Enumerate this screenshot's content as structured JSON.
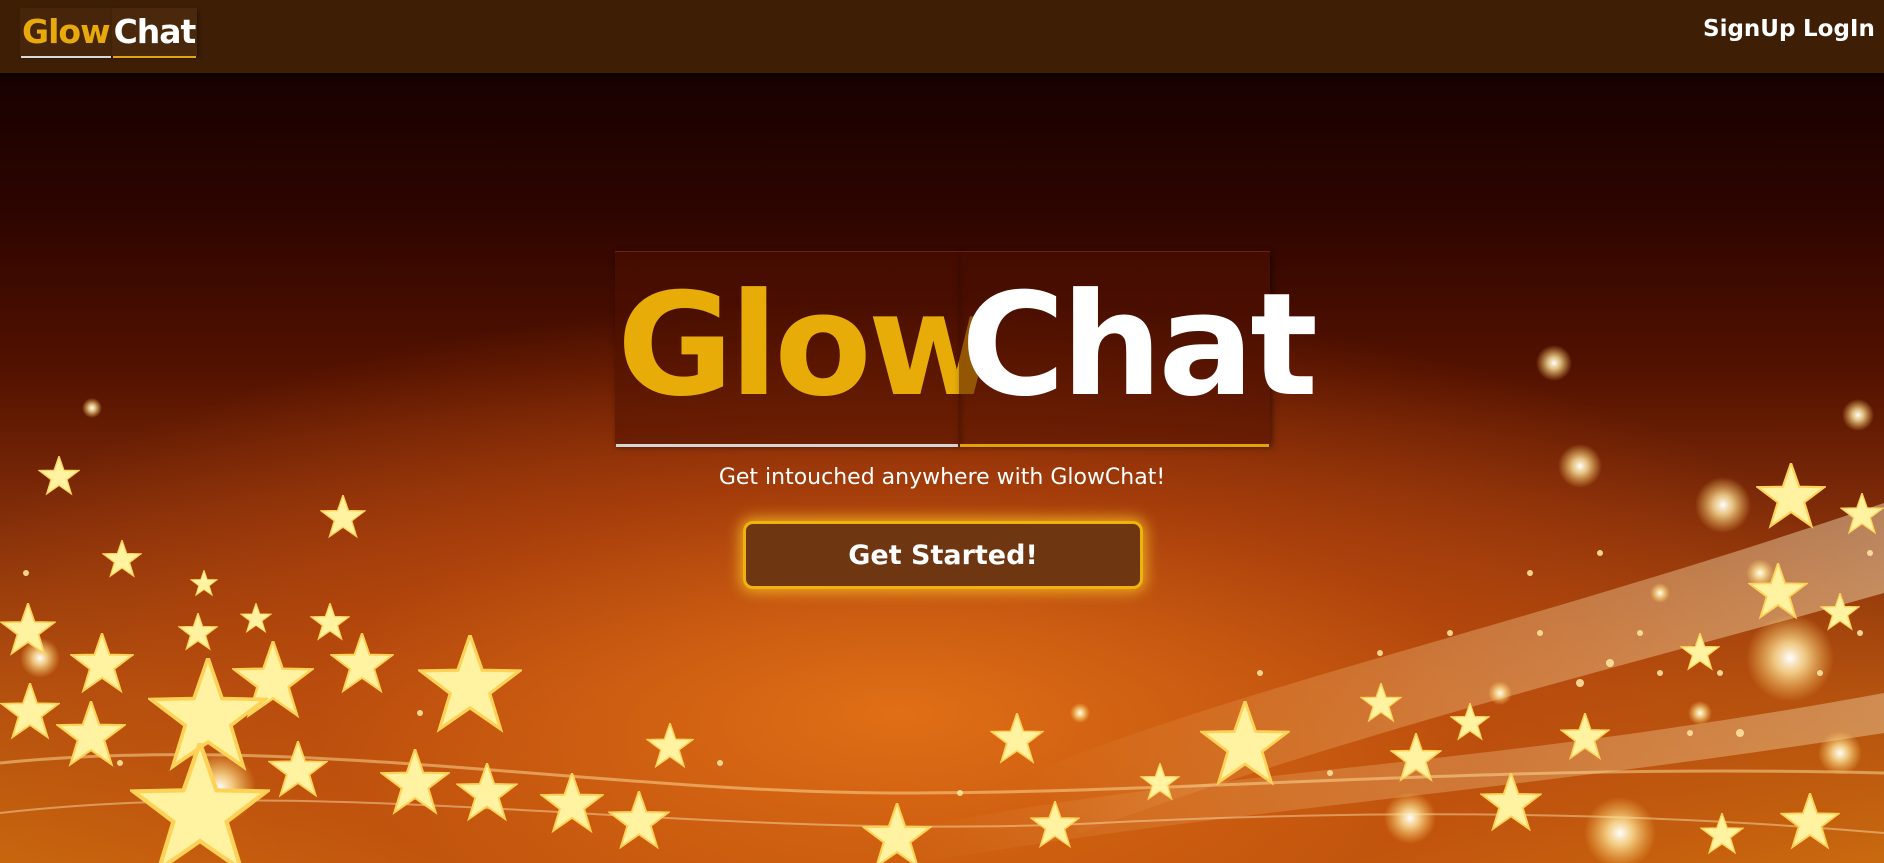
{
  "navbar": {
    "logo": {
      "glow": "Glow",
      "chat": "Chat"
    },
    "links": {
      "signup": "SignUp",
      "login": "LogIn"
    }
  },
  "hero": {
    "logo": {
      "glow": "Glow",
      "chat": "Chat"
    },
    "tagline": "Get intouched anywhere with GlowChat!",
    "cta_label": "Get Started!"
  },
  "colors": {
    "brand_gold": "#e7ac08",
    "navbar_bg": "#3e1f06",
    "button_bg": "#6e3611",
    "button_border": "#f0b20c"
  }
}
